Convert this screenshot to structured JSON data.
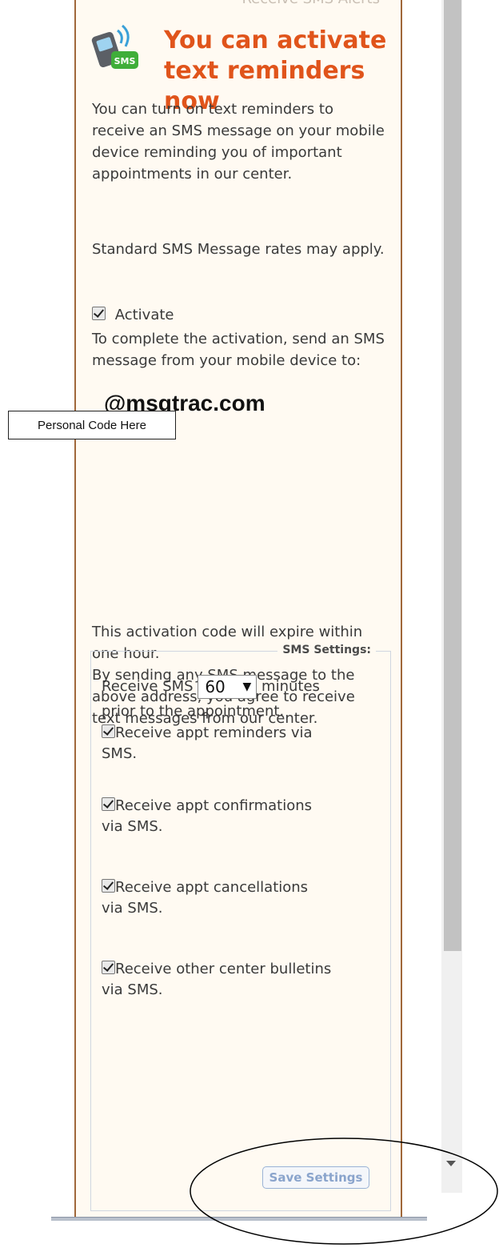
{
  "panel": {
    "legend": "Receive SMS Alerts",
    "headline": "You can activate text reminders now",
    "intro": "You can turn on text reminders to receive an SMS message on your mobile device reminding you of important appointments in our center.",
    "rates_note": "Standard SMS Message rates may apply.",
    "activate_label": "Activate",
    "activation_instructions": "To complete the activation, send an SMS message from your mobile device to:",
    "personal_code_placeholder": "Personal Code Here",
    "email_domain": "@msgtrac.com",
    "expiry_note": "This activation code will expire within one hour.",
    "agreement_note": "By sending any SMS message to the above address, you agree to receive text messages from our center.",
    "icon_badge": "SMS"
  },
  "sms_settings": {
    "title": "SMS Settings:",
    "receive_prefix": "Receive SMS",
    "minutes_value": "60",
    "minutes_suffix": "minutes",
    "prior_text": "prior to the appointment.",
    "options": [
      {
        "label_line1": "Receive appt reminders via",
        "label_line2": "SMS.",
        "checked": true
      },
      {
        "label_line1": "Receive appt confirmations",
        "label_line2": "via SMS.",
        "checked": true
      },
      {
        "label_line1": "Receive appt cancellations",
        "label_line2": "via SMS.",
        "checked": true
      },
      {
        "label_line1": "Receive other center bulletins",
        "label_line2": "via SMS.",
        "checked": true
      }
    ],
    "save_label": "Save Settings"
  },
  "colors": {
    "headline": "#e0541b",
    "panel_bg": "#fffaf2",
    "panel_border": "#a0673a",
    "button_text": "#8aa4cc"
  }
}
